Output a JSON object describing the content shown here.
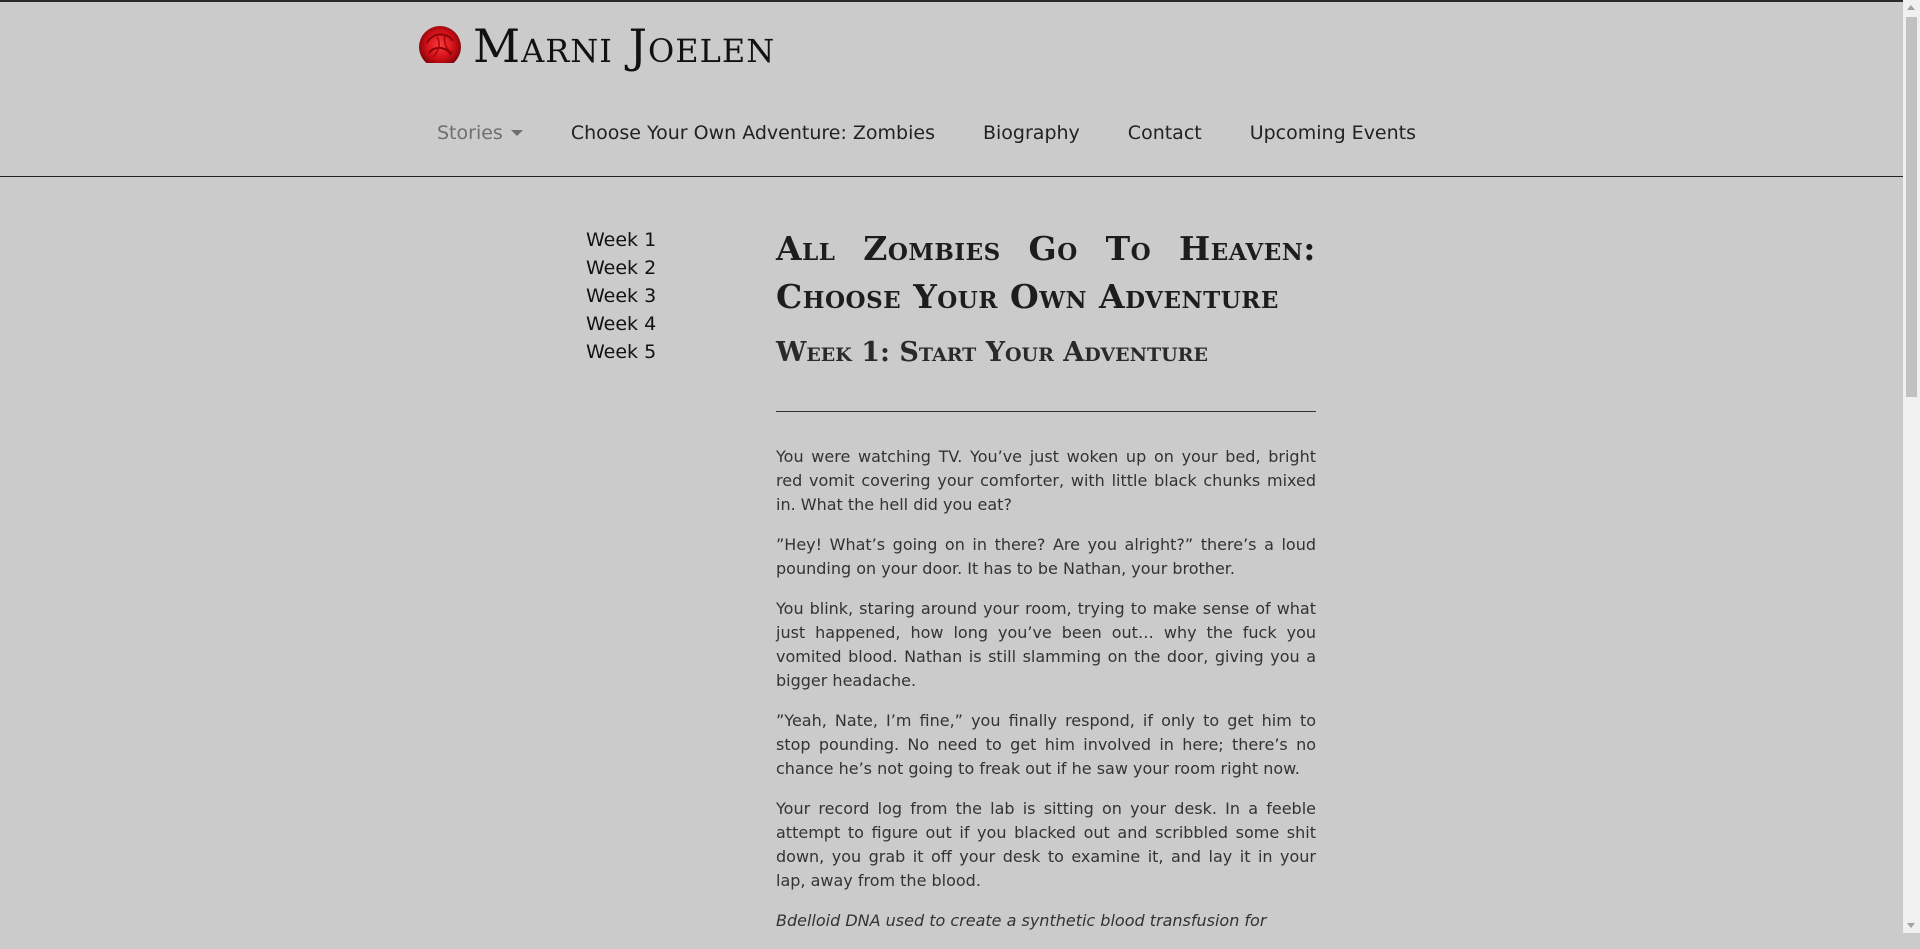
{
  "brand": {
    "name": "Marni Joelen",
    "logo_icon": "red-rose-icon"
  },
  "nav": {
    "items": [
      {
        "label": "Stories"
      },
      {
        "label": "Choose Your Own Adventure: Zombies"
      },
      {
        "label": "Biography"
      },
      {
        "label": "Contact"
      },
      {
        "label": "Upcoming Events"
      }
    ]
  },
  "sidebar": {
    "items": [
      {
        "label": "Week 1"
      },
      {
        "label": "Week 2"
      },
      {
        "label": "Week 3"
      },
      {
        "label": "Week 4"
      },
      {
        "label": "Week 5"
      }
    ]
  },
  "article": {
    "title": "All Zombies Go To Heaven: Choose Your Own Adventure",
    "subtitle": "Week 1: Start Your Adventure",
    "paragraphs": [
      "You were watching TV. You’ve just woken up on your bed, bright red vomit covering your comforter, with little black chunks mixed in. What the hell did you eat?",
      "”Hey! What’s going on in there? Are you alright?” there’s a loud pounding on your door. It has to be Nathan, your brother.",
      "You blink, staring around your room, trying to make sense of what just happened, how long you’ve been out… why the fuck you vomited blood. Nathan is still slamming on the door, giving you a bigger headache.",
      "”Yeah, Nate, I’m fine,” you finally respond, if only to get him to stop pounding. No need to get him involved in here; there’s no chance he’s not going to freak out if he saw your room right now.",
      "Your record log from the lab is sitting on your desk. In a feeble attempt to figure out if you blacked out and scribbled some shit down, you grab it off your desk to examine it, and lay it in your lap, away from the blood.",
      "Bdelloid DNA used to create a synthetic blood transfusion for"
    ]
  }
}
